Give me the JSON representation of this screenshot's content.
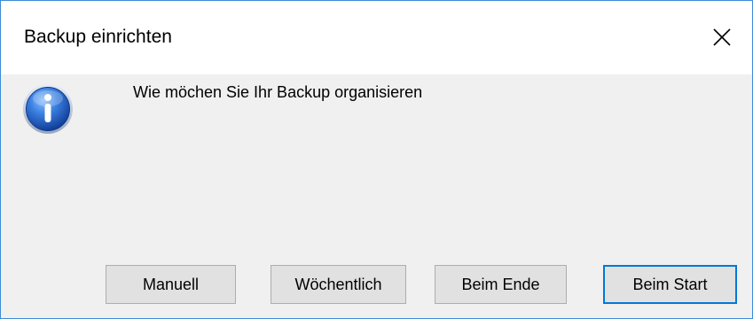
{
  "window": {
    "title": "Backup einrichten",
    "close_icon": "close-icon"
  },
  "dialog": {
    "icon": "info-icon",
    "message": "Wie möchen Sie Ihr Backup organisieren"
  },
  "buttons": {
    "manuell": "Manuell",
    "woechentlich": "Wöchentlich",
    "beim_ende": "Beim Ende",
    "beim_start": "Beim Start",
    "default_button": "Beim Start"
  },
  "colors": {
    "window_border": "#3c8cd6",
    "dialog_background": "#f0f0f0",
    "button_face": "#e1e1e1",
    "default_button_border": "#0078d7",
    "icon_blue": "#1f5fc0"
  }
}
